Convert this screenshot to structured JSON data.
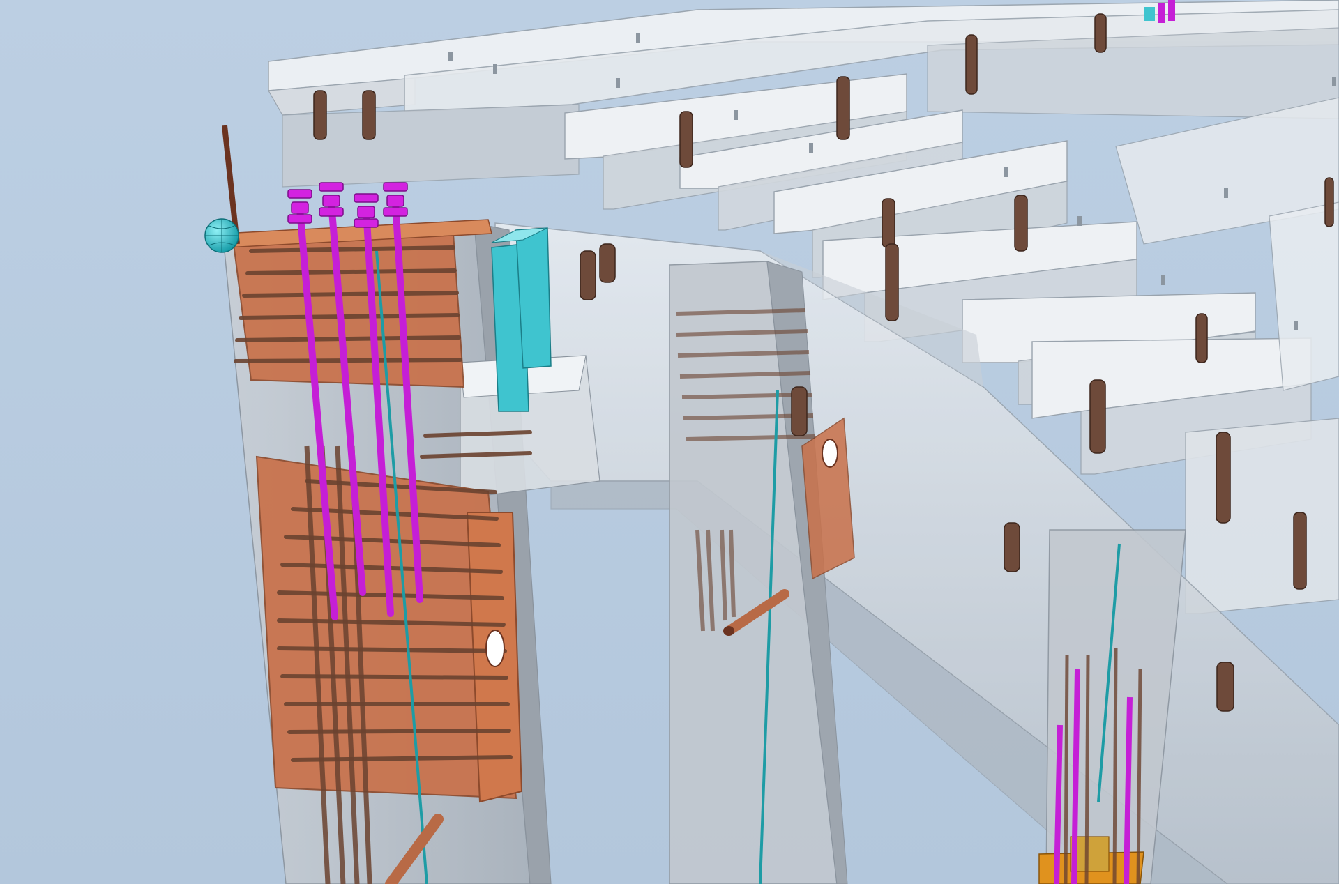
{
  "scene": {
    "colors": {
      "sky": "#b7cbe0",
      "concrete_face": "#cdd3da",
      "concrete_dark": "#8d959e",
      "slab_light": "#eef1f4",
      "embed_plate": "#c9714a",
      "rebar": "#6b4330",
      "anchor_bolt": "#c51fd6",
      "blockout": "#3fc4cf",
      "pipe": "#b86a46"
    },
    "icons": [
      "sphere-marker-icon"
    ]
  }
}
